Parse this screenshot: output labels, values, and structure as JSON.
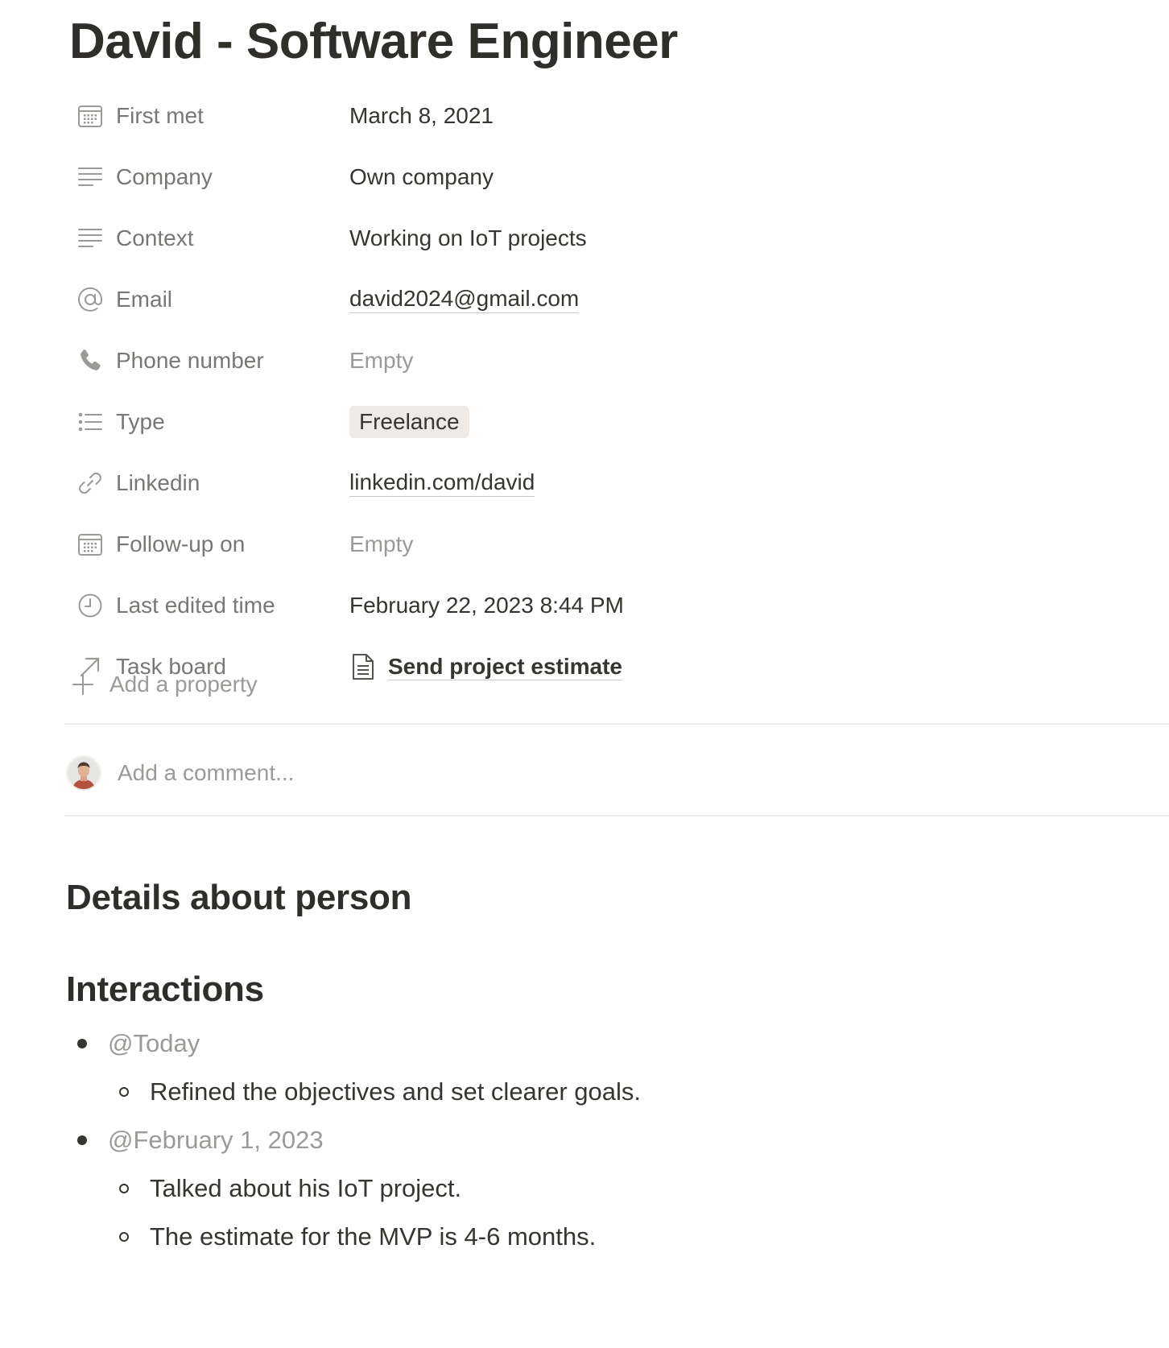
{
  "page": {
    "title": "David - Software Engineer"
  },
  "properties": [
    {
      "label": "First met",
      "icon": "calendar-icon",
      "value": "March 8, 2021",
      "kind": "date"
    },
    {
      "label": "Company",
      "icon": "text-lines-icon",
      "value": "Own company",
      "kind": "text"
    },
    {
      "label": "Context",
      "icon": "text-lines-icon",
      "value": "Working on IoT projects",
      "kind": "text"
    },
    {
      "label": "Email",
      "icon": "at-sign-icon",
      "value": "david2024@gmail.com",
      "kind": "email"
    },
    {
      "label": "Phone number",
      "icon": "phone-icon",
      "value": "Empty",
      "kind": "empty"
    },
    {
      "label": "Type",
      "icon": "list-icon",
      "value": "Freelance",
      "kind": "tag"
    },
    {
      "label": "Linkedin",
      "icon": "link-icon",
      "value": "linkedin.com/david",
      "kind": "url"
    },
    {
      "label": "Follow-up on",
      "icon": "calendar-icon",
      "value": "Empty",
      "kind": "empty"
    },
    {
      "label": "Last edited time",
      "icon": "clock-icon",
      "value": "February 22, 2023 8:44 PM",
      "kind": "text"
    },
    {
      "label": "Task board",
      "icon": "arrow-up-right-icon",
      "value": "Send project estimate",
      "kind": "relation"
    }
  ],
  "add_property": {
    "label": "Add a property"
  },
  "comment": {
    "placeholder": "Add a comment..."
  },
  "sections": {
    "details_heading": "Details about person",
    "interactions_heading": "Interactions"
  },
  "interactions": [
    {
      "mention": "@Today",
      "notes": [
        "Refined the objectives and set clearer goals."
      ]
    },
    {
      "mention": "@February 1, 2023",
      "notes": [
        "Talked about his IoT project.",
        "The estimate for the MVP is 4-6 months."
      ]
    }
  ],
  "colors": {
    "text": "#37352f",
    "muted": "#787774",
    "placeholder": "#9b9a97",
    "tag_bg": "#eeeae7",
    "divider": "#ebebea"
  }
}
